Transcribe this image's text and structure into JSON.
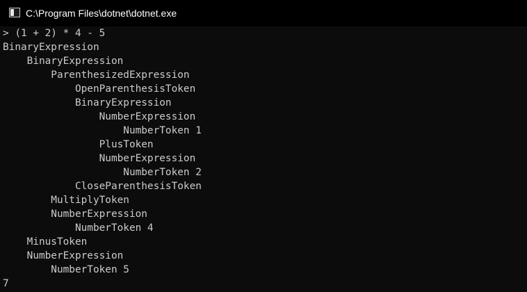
{
  "window": {
    "title": "C:\\Program Files\\dotnet\\dotnet.exe",
    "icon": "console-app-icon"
  },
  "console": {
    "lines": [
      "> (1 + 2) * 4 - 5",
      "BinaryExpression",
      "    BinaryExpression",
      "        ParenthesizedExpression",
      "            OpenParenthesisToken",
      "            BinaryExpression",
      "                NumberExpression",
      "                    NumberToken 1",
      "                PlusToken",
      "                NumberExpression",
      "                    NumberToken 2",
      "            CloseParenthesisToken",
      "        MultiplyToken",
      "        NumberExpression",
      "            NumberToken 4",
      "    MinusToken",
      "    NumberExpression",
      "        NumberToken 5",
      "7"
    ]
  },
  "colors": {
    "background": "#0c0c0c",
    "titlebar": "#000000",
    "text": "#cccccc",
    "title_text": "#ffffff"
  }
}
